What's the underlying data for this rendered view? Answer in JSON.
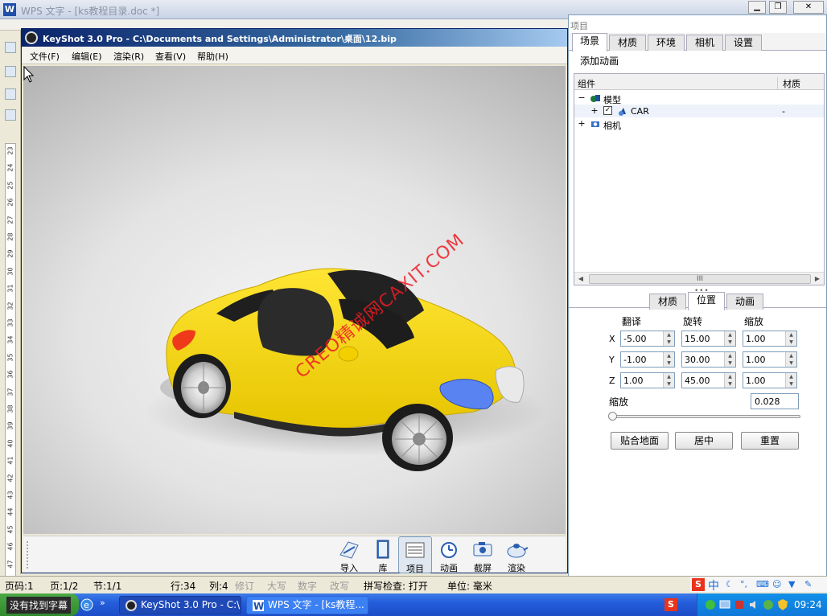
{
  "wps": {
    "title": "WPS 文字 - [ks教程目录.doc *]",
    "ruler_numbers": [
      "23",
      "24",
      "25",
      "26",
      "27",
      "28",
      "29",
      "30",
      "31",
      "32",
      "33",
      "34",
      "35",
      "36",
      "37",
      "38",
      "39",
      "40",
      "41",
      "42",
      "43",
      "44",
      "45",
      "46",
      "47"
    ]
  },
  "keyshot": {
    "title": "KeyShot 3.0 Pro  - C:\\Documents and Settings\\Administrator\\桌面\\12.bip",
    "menu": [
      "文件(F)",
      "编辑(E)",
      "渲染(R)",
      "查看(V)",
      "帮助(H)"
    ],
    "watermark": "CREO精诚网CAXIT.COM",
    "toolbar": [
      {
        "label": "导入",
        "icon": "import-icon"
      },
      {
        "label": "库",
        "icon": "library-icon"
      },
      {
        "label": "项目",
        "icon": "project-icon"
      },
      {
        "label": "动画",
        "icon": "animation-icon"
      },
      {
        "label": "截屏",
        "icon": "screenshot-icon"
      },
      {
        "label": "渲染",
        "icon": "render-icon"
      }
    ],
    "active_tool": "项目"
  },
  "project": {
    "title": "项目",
    "tabs": [
      "场景",
      "材质",
      "环境",
      "相机",
      "设置"
    ],
    "active_tab": "场景",
    "add_animation": "添加动画",
    "tree": {
      "col_component": "组件",
      "col_material": "材质",
      "rows": [
        {
          "expander": "−",
          "label": "模型",
          "material": ""
        },
        {
          "expander": "+",
          "label": "CAR",
          "material": "-",
          "checked": true
        },
        {
          "expander": "+",
          "label": "相机",
          "material": ""
        }
      ],
      "scroll_thumb": "III"
    },
    "sub_tabs": [
      "材质",
      "位置",
      "动画"
    ],
    "active_sub_tab": "位置",
    "position": {
      "col_translate": "翻译",
      "col_rotate": "旋转",
      "col_scale": "缩放",
      "rows": [
        {
          "axis": "X",
          "translate": "-5.00",
          "rotate": "15.00",
          "scale": "1.00"
        },
        {
          "axis": "Y",
          "translate": "-1.00",
          "rotate": "30.00",
          "scale": "1.00"
        },
        {
          "axis": "Z",
          "translate": "1.00",
          "rotate": "45.00",
          "scale": "1.00"
        }
      ],
      "scale_label": "缩放",
      "scale_value": "0.028",
      "buttons": [
        "贴合地面",
        "居中",
        "重置"
      ]
    }
  },
  "statusbar": {
    "page": "页码:1",
    "pages": "页:1/2",
    "section": "节:1/1",
    "line": "行:34",
    "column": "列:4",
    "revise": "修订",
    "caps": "大写",
    "num": "数字",
    "overwrite": "改写",
    "spellcheck": "拼写检查: 打开",
    "unit": "单位: 毫米"
  },
  "ime": {
    "s": "S",
    "zh": "中"
  },
  "taskbar": {
    "start_tip": "没有找到字幕",
    "tasks": [
      {
        "label": "KeyShot 3.0 Pro  - C:\\...",
        "active": true
      },
      {
        "label": "WPS 文字 - [ks教程...",
        "active": false
      }
    ],
    "s_square": "S",
    "clock": "09:24"
  },
  "colors": {
    "car_body": "#f4d400",
    "car_light": "#4f7df0",
    "watermark": "#ee1c25",
    "title_blue": "#0a246a"
  }
}
